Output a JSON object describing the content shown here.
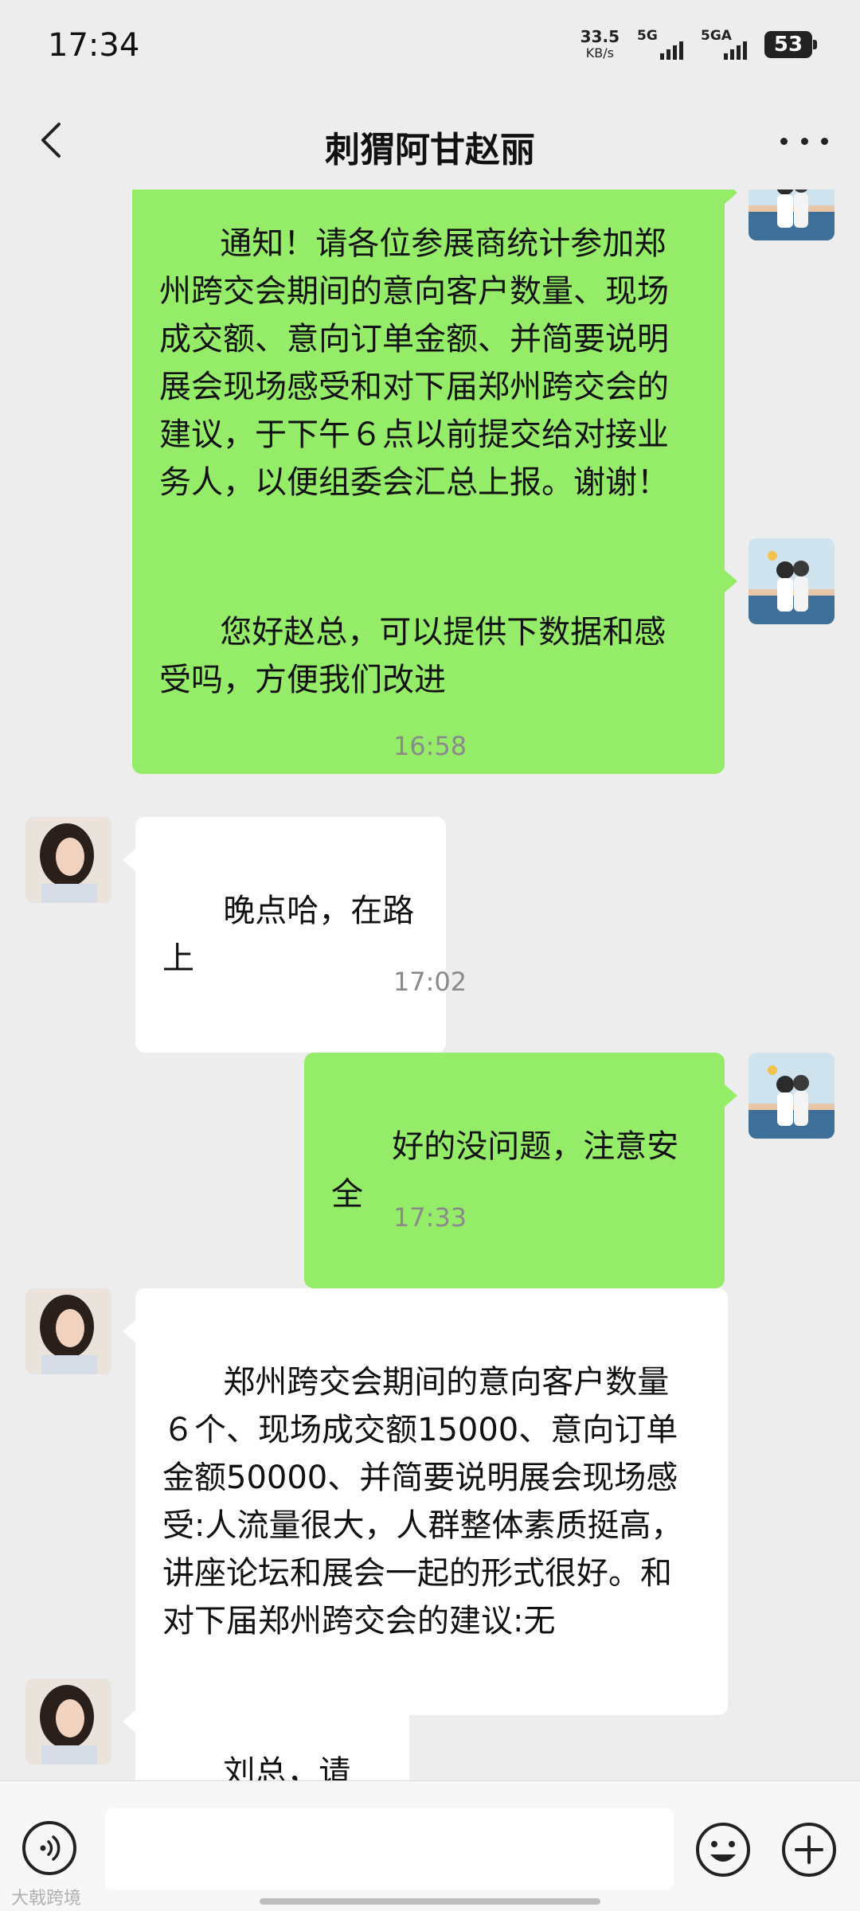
{
  "status_bar": {
    "time": "17:34",
    "net_speed_value": "33.5",
    "net_speed_unit": "KB/s",
    "sim1_label": "5G",
    "sim2_label": "5GA",
    "battery": "53"
  },
  "nav": {
    "title": "刺猬阿甘赵丽",
    "back_icon": "chevron-left-icon",
    "more_icon": "more-dots-icon"
  },
  "messages": [
    {
      "side": "out",
      "text": "通知！请各位参展商统计参加郑州跨交会期间的意向客户数量、现场成交额、意向订单金额、并简要说明展会现场感受和对下届郑州跨交会的建议，于下午６点以前提交给对接业务人，以便组委会汇总上报。谢谢！"
    },
    {
      "side": "out",
      "text": "您好赵总，可以提供下数据和感受吗，方便我们改进"
    },
    {
      "timestamp": "16:58"
    },
    {
      "side": "in",
      "text": "晚点哈，在路上"
    },
    {
      "timestamp": "17:02"
    },
    {
      "side": "out",
      "text": "好的没问题，注意安全"
    },
    {
      "timestamp": "17:33"
    },
    {
      "side": "in",
      "text": "郑州跨交会期间的意向客户数量６个、现场成交额15000、意向订单金额50000、并简要说明展会现场感受:人流量很大，人群整体素质挺高，讲座论坛和展会一起的形式很好。和对下届郑州跨交会的建议:无"
    },
    {
      "side": "in",
      "text": "刘总，请查收"
    }
  ],
  "input_bar": {
    "voice_icon": "voice-icon",
    "emoji_icon": "emoji-icon",
    "plus_icon": "plus-icon",
    "text_value": ""
  },
  "watermark": "大戟跨境",
  "colors": {
    "background": "#ededed",
    "outgoing_bubble": "#95ec69",
    "incoming_bubble": "#ffffff",
    "timestamp_text": "#8a8a8a"
  }
}
